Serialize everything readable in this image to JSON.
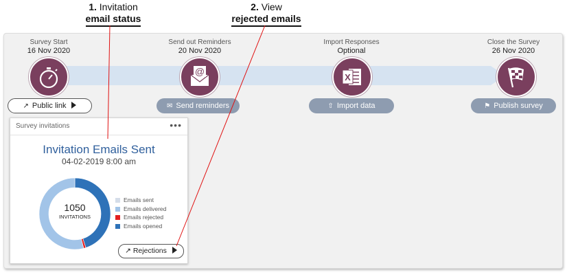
{
  "callouts": [
    {
      "num": "1.",
      "line1": "Invitation",
      "line2": "email status"
    },
    {
      "num": "2.",
      "line1": "View",
      "line2": "rejected emails"
    }
  ],
  "steps": [
    {
      "title": "Survey Start",
      "date": "16 Nov 2020",
      "icon": "stopwatch-icon"
    },
    {
      "title": "Send out Reminders",
      "date": "20 Nov 2020",
      "icon": "email-envelope-icon"
    },
    {
      "title": "Import Responses",
      "date": "Optional",
      "icon": "excel-icon"
    },
    {
      "title": "Close the Survey",
      "date": "26 Nov 2020",
      "icon": "checkered-flag-icon"
    }
  ],
  "buttons": {
    "public_link": "Public link",
    "send_reminders": "Send reminders",
    "import_data": "Import data",
    "publish_survey": "Publish survey",
    "rejections": "Rejections"
  },
  "card": {
    "header": "Survey invitations",
    "menu": "•••",
    "title": "Invitation Emails Sent",
    "datetime": "04-02-2019 8:00 am",
    "total": "1050",
    "total_label": "INVITATIONS",
    "legend": [
      {
        "label": "Emails sent",
        "color": "#d5dde9"
      },
      {
        "label": "Emails delivered",
        "color": "#a2c4e8"
      },
      {
        "label": "Emails rejected",
        "color": "#e32020"
      },
      {
        "label": "Emails opened",
        "color": "#2e72b8"
      }
    ],
    "donut_fractions": {
      "opened": 0.45,
      "rejected": 0.01,
      "delivered": 0.54
    }
  },
  "colors": {
    "accent_step": "#7a3f5e",
    "pill": "#8e9cb0",
    "band": "#d6e3f1",
    "title_blue": "#2f5f9c",
    "callout_line": "#e01010"
  }
}
